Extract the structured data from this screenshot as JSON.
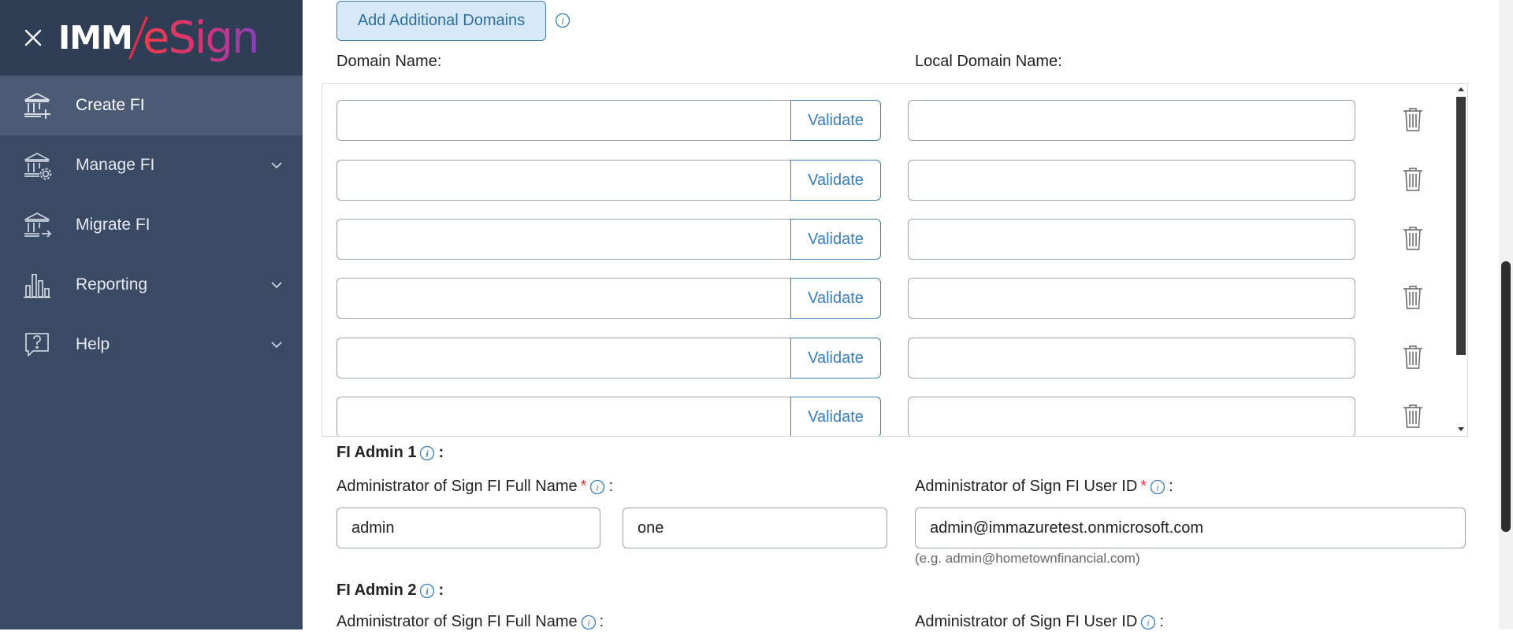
{
  "app": {
    "brand_prefix": "IMM",
    "brand_suffix": "eSign"
  },
  "sidebar": {
    "items": [
      {
        "label": "Create FI",
        "icon": "bank-add-icon",
        "active": true
      },
      {
        "label": "Manage FI",
        "icon": "bank-settings-icon",
        "expandable": true
      },
      {
        "label": "Migrate FI",
        "icon": "bank-migrate-icon",
        "expandable": false
      },
      {
        "label": "Reporting",
        "icon": "bar-chart-icon",
        "expandable": true
      },
      {
        "label": "Help",
        "icon": "help-chat-icon",
        "expandable": true
      }
    ]
  },
  "domains": {
    "add_button_label": "Add Additional Domains",
    "domain_name_label": "Domain Name:",
    "local_domain_name_label": "Local Domain Name:",
    "validate_label": "Validate",
    "rows": [
      {
        "domain": "",
        "local": ""
      },
      {
        "domain": "",
        "local": ""
      },
      {
        "domain": "",
        "local": ""
      },
      {
        "domain": "",
        "local": ""
      },
      {
        "domain": "",
        "local": ""
      },
      {
        "domain": "",
        "local": ""
      }
    ]
  },
  "fi_admin_1": {
    "title": "FI Admin 1",
    "full_name_label": "Administrator of Sign FI Full Name",
    "user_id_label": "Administrator of Sign FI User ID",
    "first_name": "admin",
    "last_name": "one",
    "user_id": "admin@immazuretest.onmicrosoft.com",
    "user_id_hint": "(e.g. admin@hometownfinancial.com)"
  },
  "fi_admin_2": {
    "title": "FI Admin 2",
    "full_name_label": "Administrator of Sign FI Full Name",
    "user_id_label": "Administrator of Sign FI User ID"
  },
  "colors": {
    "sidebar_bg": "#3b4a64",
    "sidebar_header_bg": "#2f3d55",
    "active_item_bg": "#4b5b76",
    "accent_blue": "#3c80b5",
    "required_star": "#e33333"
  }
}
